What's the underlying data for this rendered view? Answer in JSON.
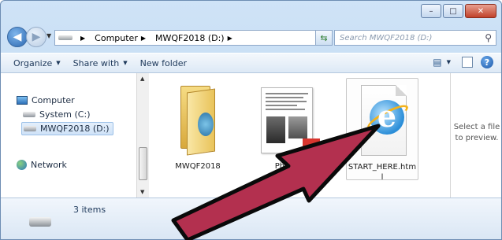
{
  "window": {
    "controls": {
      "minimize": "–",
      "maximize": "□",
      "close": "✕"
    }
  },
  "address": {
    "segments": [
      "Computer",
      "MWQF2018 (D:)"
    ],
    "search_placeholder": "Search MWQF2018 (D:)"
  },
  "toolbar": {
    "organize": "Organize",
    "share_with": "Share with",
    "new_folder": "New folder"
  },
  "nav": {
    "items": [
      {
        "label": "Computer",
        "icon": "computer-icon"
      },
      {
        "label": "System (C:)",
        "icon": "drive-icon"
      },
      {
        "label": "MWQF2018 (D:)",
        "icon": "drive-icon",
        "selected": true
      },
      {
        "label": "Network",
        "icon": "network-icon"
      }
    ]
  },
  "files": [
    {
      "name": "MWQF2018",
      "type": "folder"
    },
    {
      "name": "PhotoGuidelinesMWQF2018.pdf",
      "type": "document",
      "visible_label": "Photo\nions20"
    },
    {
      "name": "START_HERE.htm",
      "type": "web-page",
      "selected": true,
      "visible_label": "START_HERE.htm\nl"
    }
  ],
  "preview": {
    "message": "Select a file to preview."
  },
  "details": {
    "item_count": "3 items"
  },
  "annotation": {
    "arrow_color": "#b3304f",
    "arrow_outline": "#0a0a0a"
  }
}
